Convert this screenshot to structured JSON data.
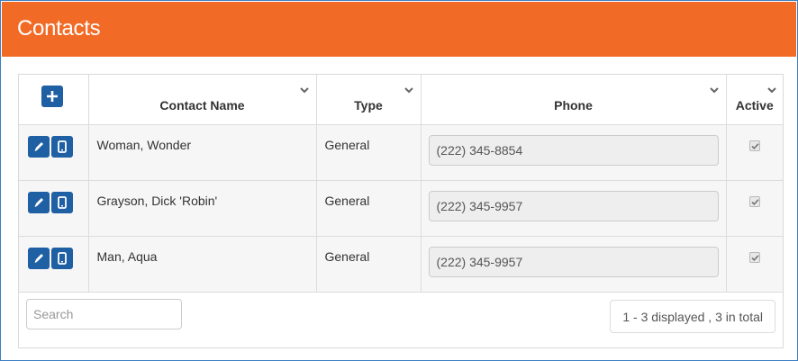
{
  "header": {
    "title": "Contacts",
    "color": "#f26b26"
  },
  "table": {
    "columns": [
      {
        "label": ""
      },
      {
        "label": "Contact Name"
      },
      {
        "label": "Type"
      },
      {
        "label": "Phone"
      },
      {
        "label": "Active"
      }
    ],
    "rows": [
      {
        "name": "Woman, Wonder",
        "type": "General",
        "phone": "(222) 345-8854",
        "active": true
      },
      {
        "name": "Grayson, Dick 'Robin'",
        "type": "General",
        "phone": "(222) 345-9957",
        "active": true
      },
      {
        "name": "Man, Aqua",
        "type": "General",
        "phone": "(222) 345-9957",
        "active": true
      }
    ]
  },
  "footer": {
    "search_placeholder": "Search",
    "count_text": "1 - 3 displayed , 3 in total"
  },
  "icons": {
    "add": "plus-icon",
    "edit": "pencil-icon",
    "mobile": "mobile-phone-icon",
    "sort": "chevron-down-icon"
  },
  "colors": {
    "button": "#1f5fa3",
    "frame": "#3b7fc4"
  }
}
